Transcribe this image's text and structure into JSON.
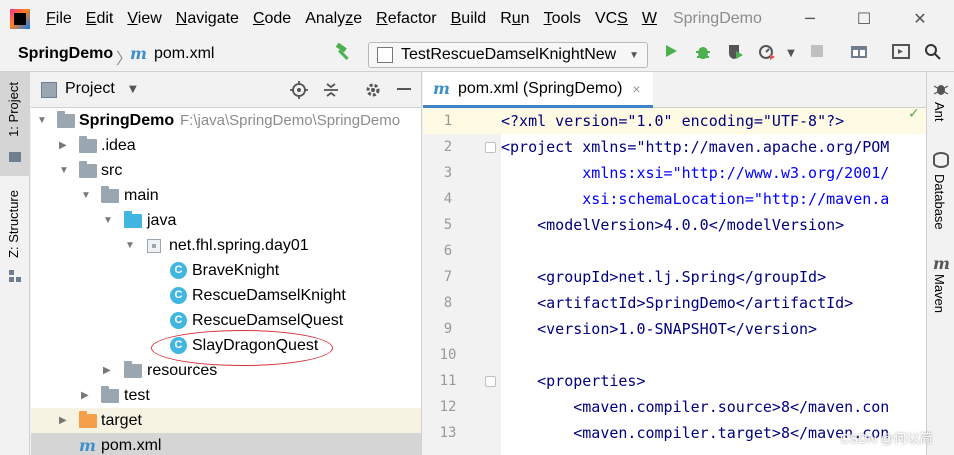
{
  "menu": {
    "items": [
      "File",
      "Edit",
      "View",
      "Navigate",
      "Code",
      "Analyze",
      "Refactor",
      "Build",
      "Run",
      "Tools",
      "VCS",
      "W"
    ],
    "mnemonics": [
      "F",
      "E",
      "V",
      "N",
      "C",
      "z",
      "R",
      "B",
      "u",
      "T",
      "S",
      "W"
    ],
    "window_title": "SpringDemo"
  },
  "window_controls": {
    "minimize": "─",
    "maximize": "☐",
    "close": "✕"
  },
  "breadcrumb": {
    "project": "SpringDemo",
    "separator": "〉",
    "file_icon": "m",
    "file": "pom.xml"
  },
  "run_config": {
    "name": "TestRescueDamselKnightNew",
    "arrow": "▼"
  },
  "left_tabs": {
    "project": "1: Project",
    "structure": "Z: Structure"
  },
  "right_tabs": {
    "ant": "Ant",
    "database": "Database",
    "maven": "Maven",
    "maven_icon": "m"
  },
  "project_panel": {
    "title": "Project",
    "arrow": "▼"
  },
  "tree": {
    "root_name": "SpringDemo",
    "root_path": "F:\\java\\SpringDemo\\SpringDemo",
    "idea": ".idea",
    "src": "src",
    "main": "main",
    "java": "java",
    "package": "net.fhl.spring.day01",
    "class_letter": "C",
    "classes": [
      "BraveKnight",
      "RescueDamselKnight",
      "RescueDamselQuest",
      "SlayDragonQuest"
    ],
    "resources": "resources",
    "test": "test",
    "target": "target",
    "pom_icon": "m",
    "pom": "pom.xml"
  },
  "editor": {
    "tab_icon": "m",
    "tab_label": "pom.xml (SpringDemo)",
    "tab_close": "×",
    "line_numbers": [
      "1",
      "2",
      "3",
      "4",
      "5",
      "6",
      "7",
      "8",
      "9",
      "10",
      "11",
      "12",
      "13"
    ],
    "status_check": "✓",
    "code": {
      "l1": "<?xml version=\"1.0\" encoding=\"UTF-8\"?>",
      "l2": "<project xmlns=\"http://maven.apache.org/POM",
      "l3": "         xmlns:xsi=\"http://www.w3.org/2001/",
      "l4": "         xsi:schemaLocation=\"http://maven.a",
      "l5": "    <modelVersion>4.0.0</modelVersion>",
      "l6": "",
      "l7": "    <groupId>net.lj.Spring</groupId>",
      "l8": "    <artifactId>SpringDemo</artifactId>",
      "l9": "    <version>1.0-SNAPSHOT</version>",
      "l10": "",
      "l11": "    <properties>",
      "l12": "        <maven.compiler.source>8</maven.con",
      "l13": "        <maven.compiler.target>8</maven.con"
    }
  },
  "watermark": "CSDN @何以简"
}
